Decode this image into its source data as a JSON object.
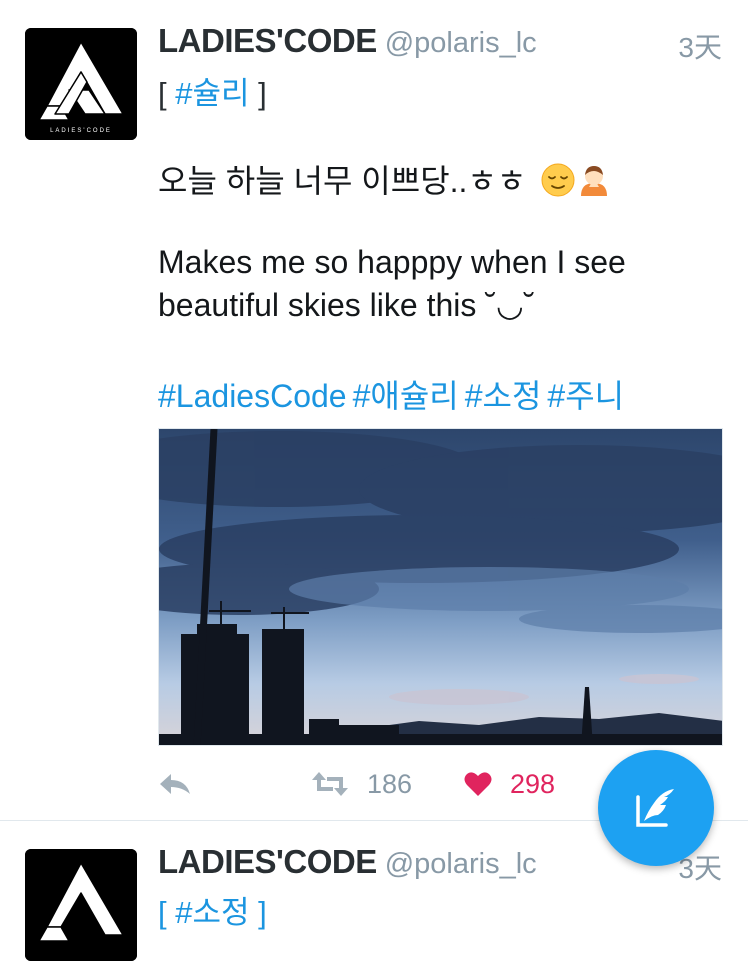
{
  "tweets": [
    {
      "display_name": "LADIES'CODE",
      "handle": "@polaris_lc",
      "time": "3天",
      "bracket_open": "[ ",
      "bracket_tag": "#슐리",
      "bracket_close": " ]",
      "text_korean": "오늘 하늘 너무 이쁘당..ㅎㅎ",
      "text_english": "Makes me so happpy when I see beautiful skies like this ˘◡˘",
      "hashtags": [
        "#LadiesCode",
        "#애슐리",
        "#소정",
        "#주니"
      ],
      "retweet_count": "186",
      "like_count": "298",
      "emojis": [
        "relieved-face",
        "person-bowing"
      ]
    },
    {
      "display_name": "LADIES'CODE",
      "handle": "@polaris_lc",
      "time": "3天",
      "bracket_text": "[ #소정 ]"
    }
  ],
  "avatar_caption": "LADIES'CODE",
  "icons": {
    "reply": "reply-icon",
    "retweet": "retweet-icon",
    "like": "heart-icon",
    "compose": "compose-quill-icon"
  },
  "colors": {
    "link": "#1b95e0",
    "like": "#e0245e",
    "meta": "#8899a6",
    "fab": "#1da1f2"
  }
}
